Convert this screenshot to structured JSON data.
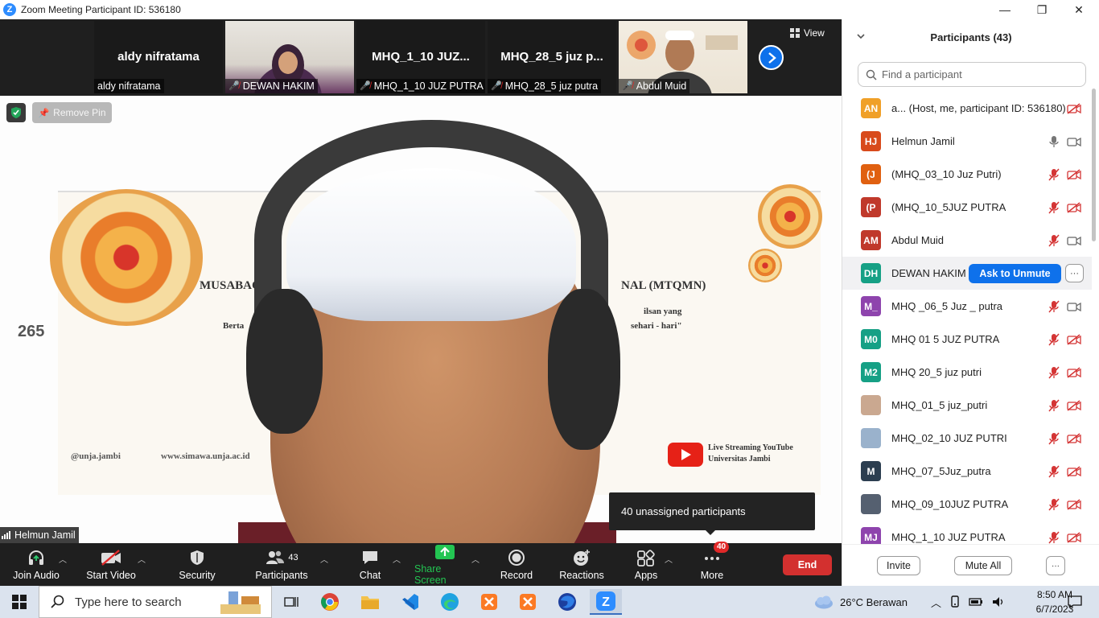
{
  "window": {
    "title": "Zoom Meeting Participant ID: 536180",
    "controls": {
      "minimize": "—",
      "maximize": "❐",
      "close": "✕"
    }
  },
  "thumbnails": [
    {
      "big_name": "aldy nifratama",
      "label": "aldy nifratama",
      "muted": false
    },
    {
      "big_name": "",
      "label": "DEWAN HAKIM",
      "muted": true
    },
    {
      "big_name": "MHQ_1_10  JUZ...",
      "label": "MHQ_1_10 JUZ PUTRA",
      "muted": true
    },
    {
      "big_name": "MHQ_28_5  juz p...",
      "label": "MHQ_28_5 juz putra",
      "muted": true
    },
    {
      "big_name": "",
      "label": "Abdul Muid",
      "muted": true
    }
  ],
  "view_label": "View",
  "main_video": {
    "remove_pin_label": "Remove Pin",
    "speaker_name": "Helmun Jamil",
    "banner": {
      "number": "265",
      "title_left": "MUSABAQ",
      "title_right": "NAL (MTQMN)",
      "line2_left": "Berta",
      "line2_right": "ilsan yang",
      "line3_right": "sehari - hari\"",
      "instagram": "@unja.jambi",
      "website": "www.simawa.unja.ac.id",
      "youtube_line1": "Live Streaming YouTube",
      "youtube_line2": "Universitas Jambi"
    },
    "tooltip": "40 unassigned participants"
  },
  "toolbar": {
    "join_audio": "Join Audio",
    "start_video": "Start Video",
    "security": "Security",
    "participants": "Participants",
    "participants_count": "43",
    "chat": "Chat",
    "share_screen": "Share Screen",
    "record": "Record",
    "reactions": "Reactions",
    "apps": "Apps",
    "more": "More",
    "more_badge": "40",
    "end": "End"
  },
  "panel": {
    "title": "Participants (43)",
    "search_placeholder": "Find a participant",
    "ask_to_unmute": "Ask to Unmute",
    "invite": "Invite",
    "mute_all": "Mute All",
    "participants": [
      {
        "initials": "AN",
        "color": "#f0a028",
        "name": "a... (Host, me, participant ID: 536180)",
        "mic": "none",
        "cam": "off"
      },
      {
        "initials": "HJ",
        "color": "#d84a1b",
        "name": "Helmun Jamil",
        "mic": "on",
        "cam": "on"
      },
      {
        "initials": "(J",
        "color": "#e06010",
        "name": "(MHQ_03_10 Juz Putri)",
        "mic": "off",
        "cam": "off"
      },
      {
        "initials": "(P",
        "color": "#c0392b",
        "name": "(MHQ_10_5JUZ PUTRA",
        "mic": "off",
        "cam": "off"
      },
      {
        "initials": "AM",
        "color": "#c0392b",
        "name": "Abdul Muid",
        "mic": "off",
        "cam": "on"
      },
      {
        "initials": "DH",
        "color": "#16a085",
        "name": "DEWAN HAKIM",
        "mic": "ask",
        "cam": "more"
      },
      {
        "initials": "M_",
        "color": "#8e44ad",
        "name": "MHQ _06_5 Juz _ putra",
        "mic": "off",
        "cam": "on"
      },
      {
        "initials": "M0",
        "color": "#16a085",
        "name": "MHQ 01 5 JUZ PUTRA",
        "mic": "off",
        "cam": "off"
      },
      {
        "initials": "M2",
        "color": "#16a085",
        "name": "MHQ 20_5 juz putri",
        "mic": "off",
        "cam": "off"
      },
      {
        "initials": "",
        "color": "#caa890",
        "name": "MHQ_01_5 juz_putri",
        "mic": "off",
        "cam": "off"
      },
      {
        "initials": "",
        "color": "#9ab2cc",
        "name": "MHQ_02_10 JUZ PUTRI",
        "mic": "off",
        "cam": "off"
      },
      {
        "initials": "M",
        "color": "#2c3e50",
        "name": "MHQ_07_5Juz_putra",
        "mic": "off",
        "cam": "off"
      },
      {
        "initials": "",
        "color": "#556070",
        "name": "MHQ_09_10JUZ PUTRA",
        "mic": "off",
        "cam": "off"
      },
      {
        "initials": "MJ",
        "color": "#8e44ad",
        "name": "MHQ_1_10 JUZ PUTRA",
        "mic": "off",
        "cam": "off"
      }
    ]
  },
  "taskbar": {
    "search_placeholder": "Type here to search",
    "weather": "26°C  Berawan",
    "time": "8:50 AM",
    "date": "6/7/2023"
  }
}
